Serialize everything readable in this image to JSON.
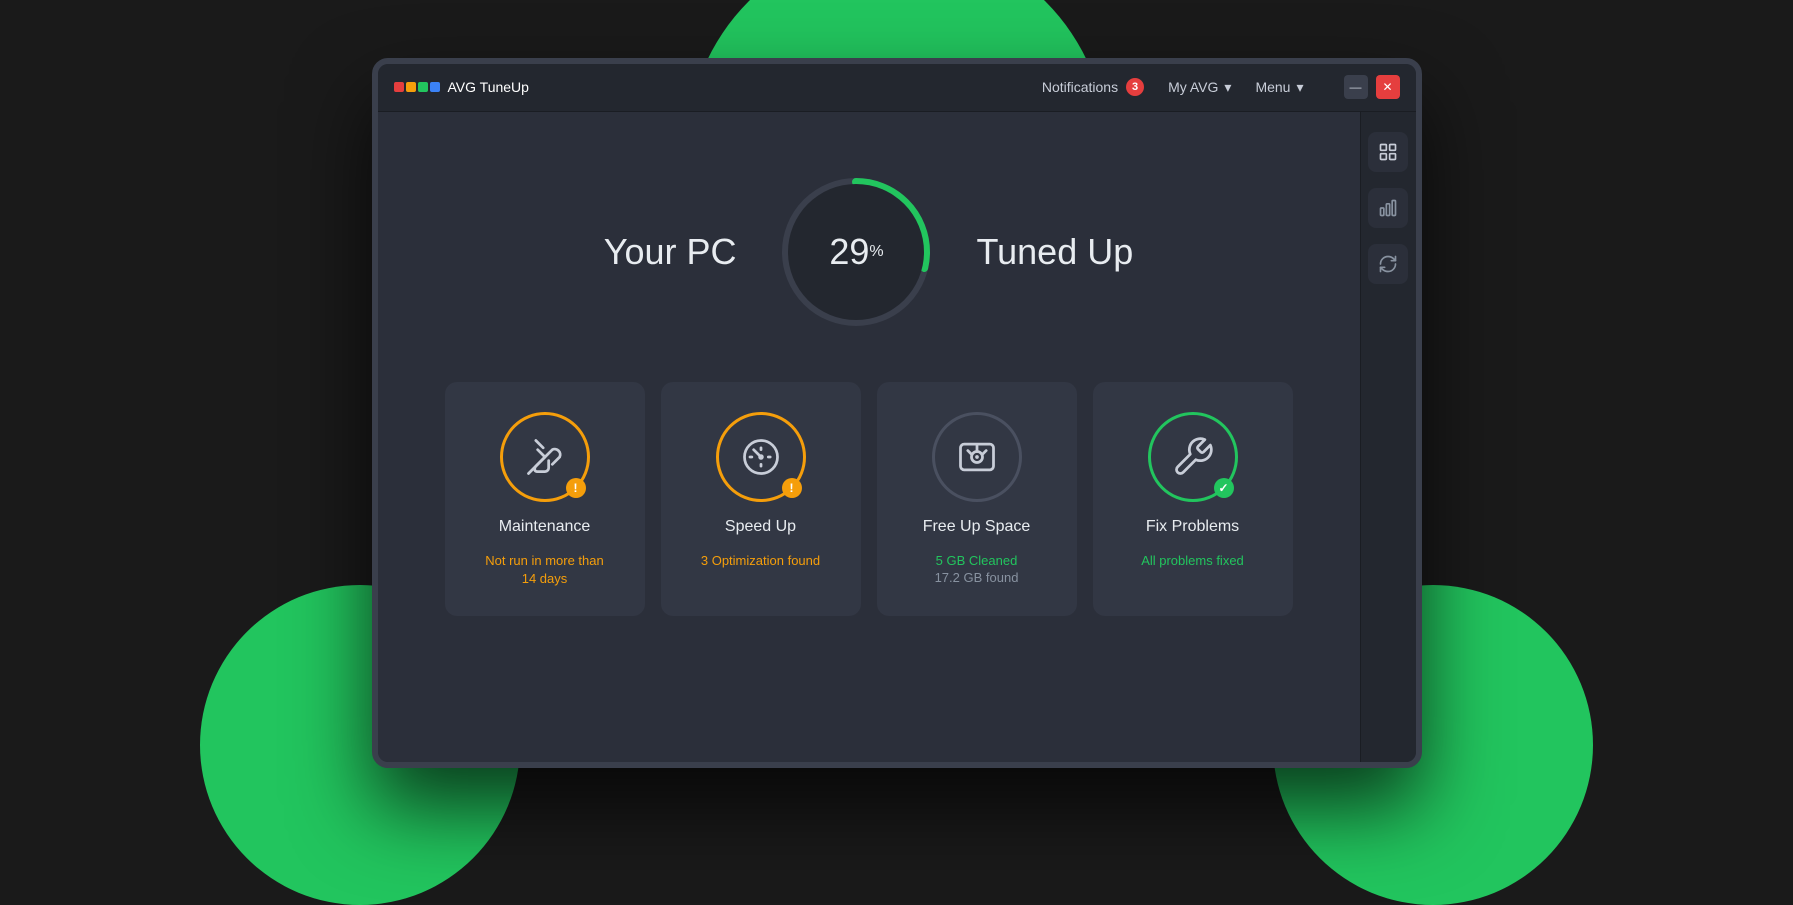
{
  "app": {
    "logo_text": "AVG TuneUp",
    "logo_colors": [
      "#e53e3e",
      "#f59e0b",
      "#22c55e",
      "#3b82f6"
    ]
  },
  "titlebar": {
    "notifications_label": "Notifications",
    "notification_count": "3",
    "my_avg_label": "My AVG",
    "menu_label": "Menu",
    "minimize_label": "—",
    "close_label": "✕"
  },
  "sidebar": {
    "icons": [
      "grid",
      "bar-chart",
      "refresh"
    ]
  },
  "gauge": {
    "left_label": "Your PC",
    "right_label": "Tuned Up",
    "percent_value": "29",
    "percent_symbol": "%",
    "progress": 29
  },
  "cards": [
    {
      "id": "maintenance",
      "title": "Maintenance",
      "status_line1": "Not run in more than",
      "status_line2": "14 days",
      "status_color": "orange",
      "badge_type": "warning",
      "badge_icon": "!",
      "ring_color": "orange"
    },
    {
      "id": "speed-up",
      "title": "Speed Up",
      "status_line1": "3 Optimization found",
      "status_line2": "",
      "status_color": "orange",
      "badge_type": "warning",
      "badge_icon": "!",
      "ring_color": "orange"
    },
    {
      "id": "free-up-space",
      "title": "Free Up Space",
      "status_line1": "5 GB Cleaned",
      "status_line2": "17.2 GB found",
      "status_color": "green",
      "badge_type": "none",
      "badge_icon": "",
      "ring_color": "gray"
    },
    {
      "id": "fix-problems",
      "title": "Fix Problems",
      "status_line1": "All problems fixed",
      "status_line2": "",
      "status_color": "green",
      "badge_type": "success",
      "badge_icon": "✓",
      "ring_color": "green"
    }
  ]
}
